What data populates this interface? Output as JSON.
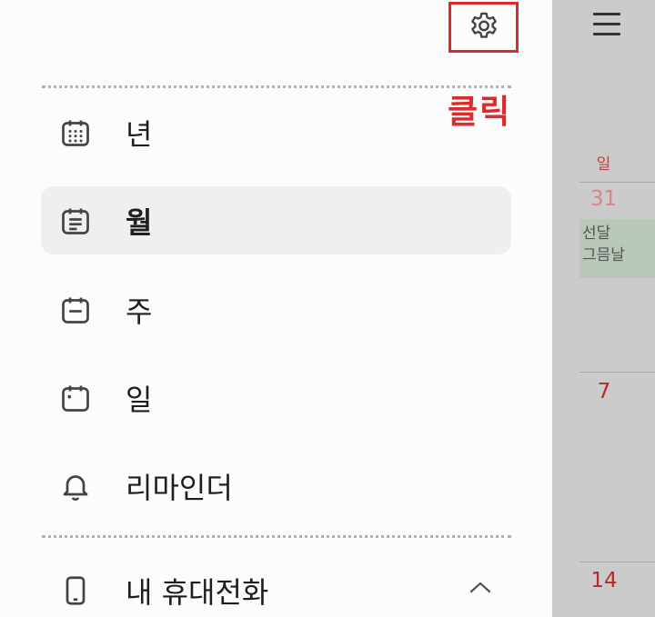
{
  "drawer": {
    "annotation_label": "클릭",
    "menu": [
      {
        "label": "년",
        "icon": "calendar-year-icon"
      },
      {
        "label": "월",
        "icon": "calendar-month-icon",
        "active": true
      },
      {
        "label": "주",
        "icon": "calendar-week-icon"
      },
      {
        "label": "일",
        "icon": "calendar-day-icon"
      },
      {
        "label": "리마인더",
        "icon": "bell-icon"
      }
    ],
    "section": {
      "label": "내 휴대전화",
      "icon": "phone-icon"
    }
  },
  "calendar": {
    "weekday": "일",
    "dates": [
      "31",
      "7",
      "14"
    ],
    "event": "선달 그믐날"
  },
  "colors": {
    "highlight": "#dd2a2a",
    "sunday": "#b32a2a",
    "active_bg": "#efefef",
    "event_bg": "#b8c9b9"
  }
}
